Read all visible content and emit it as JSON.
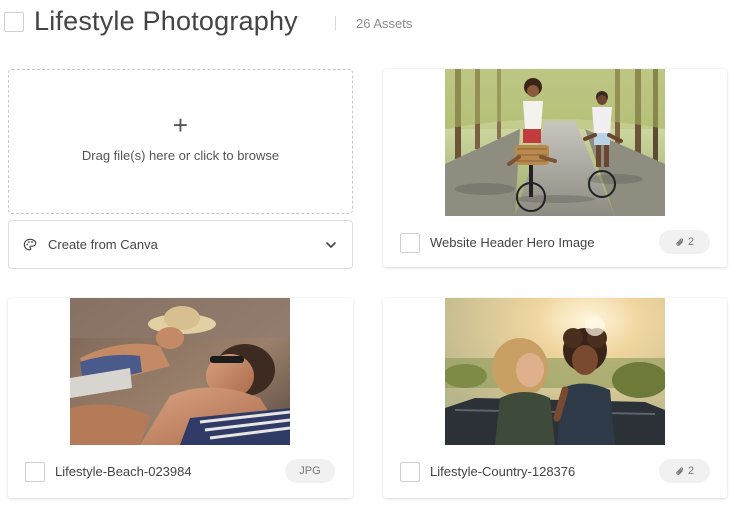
{
  "header": {
    "title": "Lifestyle Photography",
    "asset_count": "26 Assets"
  },
  "upload": {
    "plus": "+",
    "text": "Drag file(s) here or click to browse"
  },
  "canva": {
    "label": "Create from Canva",
    "icon": "palette-icon",
    "chevron": "chevron-down-icon"
  },
  "assets": [
    {
      "name": "Website Header Hero Image",
      "badge": "2",
      "badge_icon": "paperclip-icon",
      "image": "couple cycling on a tree-lined road"
    },
    {
      "name": "Lifestyle-Beach-023984",
      "badge": "JPG",
      "image": "couple sunbathing on the beach"
    },
    {
      "name": "Lifestyle-Country-128376",
      "badge": "2",
      "badge_icon": "paperclip-icon",
      "image": "two women laughing in a convertible"
    }
  ],
  "colors": {
    "text": "#444444",
    "muted": "#8a8a8a",
    "border": "#dcdcdc",
    "badge_bg": "#f1f1f1"
  }
}
